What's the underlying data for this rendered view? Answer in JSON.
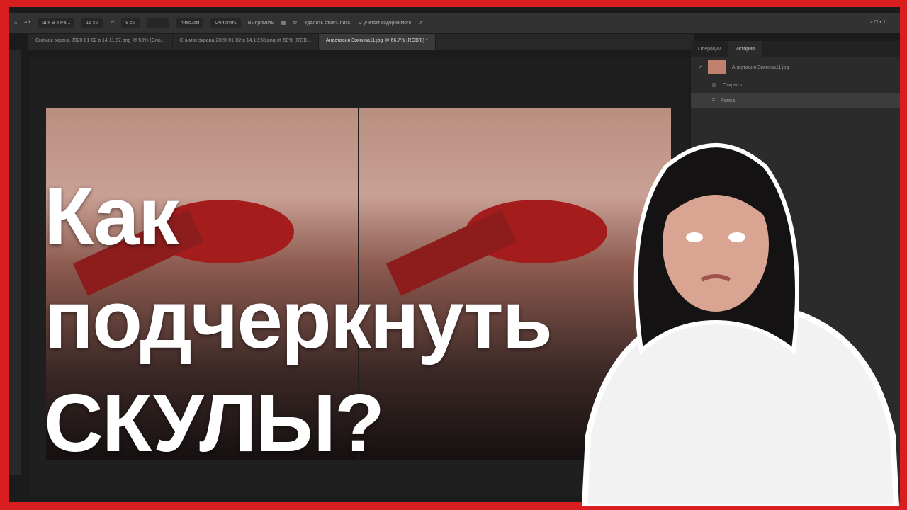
{
  "toolbar": {
    "ratio": "Ш x В x Рa...",
    "width": "15 см",
    "height": "8 см",
    "units": "пикс./см",
    "clear": "Очистить",
    "straighten": "Выпрямить",
    "delete_cropped": "Удалить отсеч. пикс.",
    "content_aware": "С учетом содержимого"
  },
  "tabs": [
    {
      "label": "Снимок экрана 2020-01-02 в 14.11.57.png @ 50% (Сло..."
    },
    {
      "label": "Снимок экрана 2020-01-02 в 14.12.58.png @ 50% (RGB..."
    },
    {
      "label": "Анастасия Звягина11.jpg @ 66,7% (RGB/8) *"
    }
  ],
  "panel": {
    "tabs": [
      "Операции",
      "История"
    ],
    "history": [
      {
        "label": "Анастасия Звягина11.jpg"
      },
      {
        "label": "Открыть"
      },
      {
        "label": "Рамка"
      }
    ]
  },
  "title": {
    "line1": "Как",
    "line2": "подчеркнуть",
    "line3": "СКУЛЫ?"
  },
  "colors": {
    "border": "#d81e1e",
    "text": "#ffffff"
  }
}
